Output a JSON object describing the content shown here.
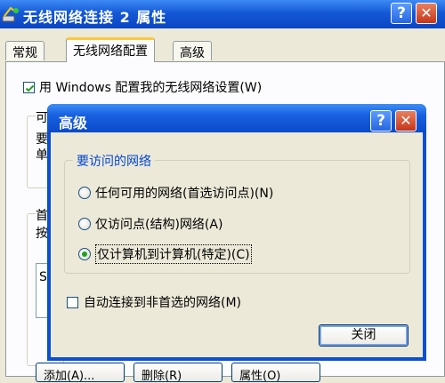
{
  "window": {
    "title": "无线网络连接 2 属性",
    "help_label": "?",
    "close_label": "✕"
  },
  "tabs": [
    {
      "label": "常规"
    },
    {
      "label": "无线网络配置"
    },
    {
      "label": "高级"
    }
  ],
  "background": {
    "use_windows_checkbox": {
      "label": "用 Windows 配置我的无线网络设置(W)",
      "checked": true
    },
    "peek_text_1": "可",
    "peek_text_2": "要",
    "peek_text_3": "单",
    "peek_text_4": "首",
    "peek_text_5": "按",
    "peek_text_6": "S",
    "buttons": [
      {
        "label": "添加(A)..."
      },
      {
        "label": "删除(R)"
      },
      {
        "label": "属性(O)"
      }
    ]
  },
  "dialog": {
    "title": "高级",
    "help_label": "?",
    "close_label": "✕",
    "group_label": "要访问的网络",
    "options": [
      {
        "label": "任何可用的网络(首选访问点)(N)",
        "selected": false
      },
      {
        "label": "仅访问点(结构)网络(A)",
        "selected": false
      },
      {
        "label": "仅计算机到计算机(特定)(C)",
        "selected": true
      }
    ],
    "auto_connect_checkbox": {
      "label": "自动连接到非首选的网络(M)",
      "checked": false
    },
    "close_button_label": "关闭"
  },
  "colors": {
    "title_blue": "#1458d6",
    "group_label_blue": "#0046d5",
    "radio_selected_green": "#21a121",
    "close_red": "#c5361b"
  }
}
